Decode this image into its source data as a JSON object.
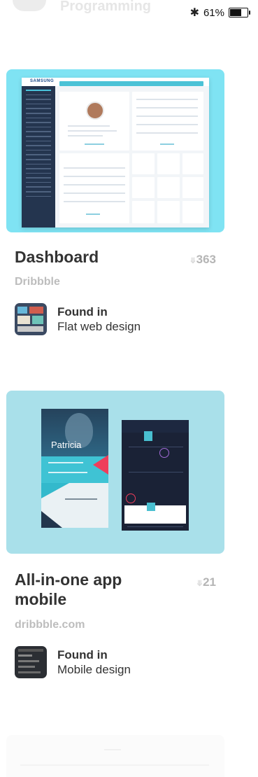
{
  "status_bar": {
    "faded_title": "Programming",
    "bluetooth_glyph": "✱",
    "battery_percent": "61%",
    "battery_level": 0.61
  },
  "pins": [
    {
      "title": "Dashboard",
      "pin_count": "363",
      "source": "Dribbble",
      "found_in_label": "Found in",
      "board": "Flat web design",
      "thumb_bg": "#7fe3f3",
      "image_brand": "SAMSUNG"
    },
    {
      "title_line1": "All-in-one app",
      "title_line2": "mobile",
      "pin_count": "21",
      "source": "dribbble.com",
      "found_in_label": "Found in",
      "board": "Mobile design",
      "thumb_bg": "#a9e0ea",
      "image_name": "Patricia"
    }
  ],
  "icons": {
    "pin": "📌"
  },
  "colors": {
    "text_dark": "#333333",
    "text_muted": "#bdbdbd",
    "accent_cyan": "#4bc2d6"
  }
}
